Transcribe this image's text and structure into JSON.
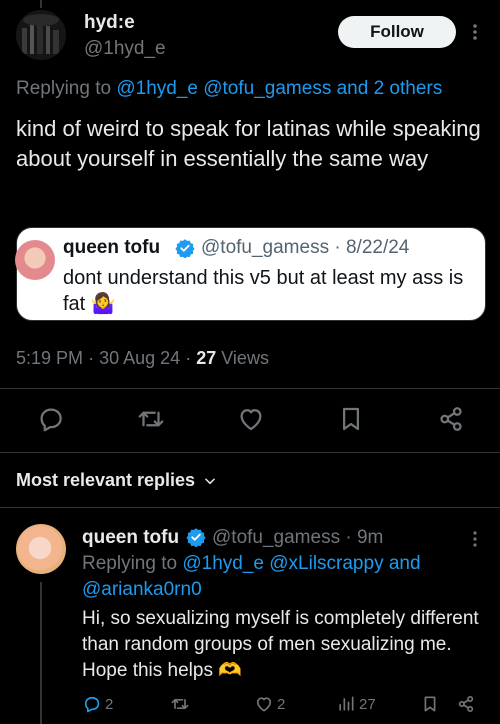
{
  "tweet": {
    "author_name": "hyd:e",
    "author_handle": "@1hyd_e",
    "follow_label": "Follow",
    "replying_prefix": "Replying to",
    "replying_mentions": "@1hyd_e @tofu_gamess and 2 others",
    "text": "kind of weird to speak for latinas while speaking about yourself in essentially the same way",
    "time": "5:19 PM",
    "date": "30 Aug 24",
    "views_count": "27",
    "views_label": "Views"
  },
  "quote": {
    "author_name": "queen tofu",
    "author_handle": "@tofu_gamess",
    "date": "8/22/24",
    "text": "dont understand this v5 but at least my ass is fat",
    "emoji": "🤷‍♀️"
  },
  "replies_section": {
    "title": "Most relevant replies"
  },
  "reply": {
    "author_name": "queen tofu",
    "author_handle": "@tofu_gamess",
    "age": "9m",
    "replying_prefix": "Replying to",
    "replying_mentions_line1": "@1hyd_e @xLilscrappy and",
    "replying_mentions_line2": "@arianka0rn0",
    "text": "Hi, so sexualizing myself is completely different than random groups of men sexualizing me. Hope this helps",
    "emoji": "🫶",
    "reply_count": "2",
    "like_count": "2",
    "view_count": "27"
  },
  "colors": {
    "background": "#000000",
    "link": "#1d9bf0",
    "muted": "#71767b",
    "verified": "#1d9bf0"
  }
}
